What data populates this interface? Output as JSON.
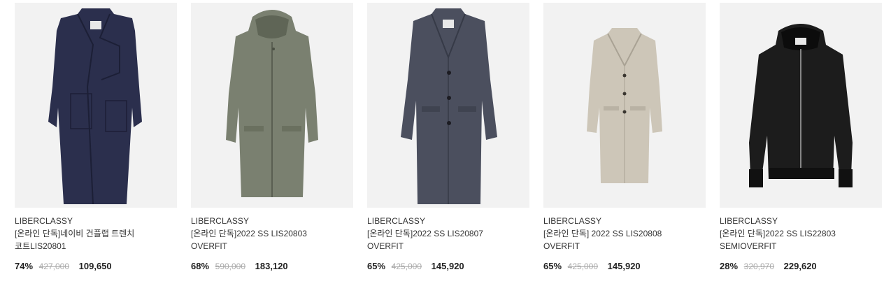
{
  "products": [
    {
      "brand": "LIBERCLASSY",
      "name_line1": "[온라인 단독]네이비 건플랩 트렌치",
      "name_line2": "코트LIS20801",
      "discount": "74%",
      "original_price": "427,000",
      "sale_price": "109,650",
      "image": "navy-trench-coat",
      "color": "#2b2f4d"
    },
    {
      "brand": "LIBERCLASSY",
      "name_line1": "[온라인 단독]2022 SS LIS20803",
      "name_line2": "OVERFIT",
      "discount": "68%",
      "original_price": "590,000",
      "sale_price": "183,120",
      "image": "khaki-hooded-coat",
      "color": "#7a8070"
    },
    {
      "brand": "LIBERCLASSY",
      "name_line1": "[온라인 단독]2022 SS LIS20807",
      "name_line2": "OVERFIT",
      "discount": "65%",
      "original_price": "425,000",
      "sale_price": "145,920",
      "image": "grey-long-coat",
      "color": "#4b4f5e"
    },
    {
      "brand": "LIBERCLASSY",
      "name_line1": "[온라인 단독] 2022 SS LIS20808",
      "name_line2": "OVERFIT",
      "discount": "65%",
      "original_price": "425,000",
      "sale_price": "145,920",
      "image": "beige-short-coat",
      "color": "#cdc6b8"
    },
    {
      "brand": "LIBERCLASSY",
      "name_line1": "[온라인 단독]2022 SS LIS22803",
      "name_line2": "SEMIOVERFIT",
      "discount": "28%",
      "original_price": "320,970",
      "sale_price": "229,620",
      "image": "black-hooded-bomber",
      "color": "#1c1c1c"
    }
  ]
}
